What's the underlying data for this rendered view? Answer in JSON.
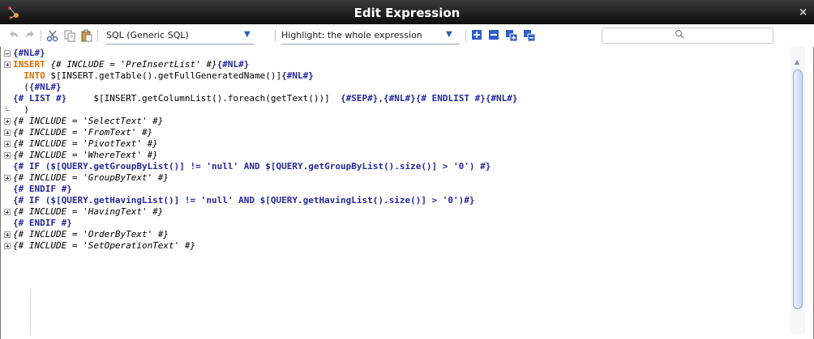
{
  "window": {
    "title": "Edit Expression",
    "close_glyph": "×"
  },
  "toolbar": {
    "language_select": "SQL (Generic SQL)",
    "highlight_select": "Highlight: the whole expression",
    "search_placeholder": ""
  },
  "editor": {
    "lines": [
      {
        "g": "minus",
        "segs": [
          {
            "c": "tpl",
            "t": "{#NL#}"
          }
        ]
      },
      {
        "g": "plus",
        "segs": [
          {
            "c": "kw",
            "t": "INSERT"
          },
          {
            "c": "it",
            "t": " {# INCLUDE = 'PreInsertList' #}"
          },
          {
            "c": "tpl",
            "t": "{#NL#}"
          }
        ]
      },
      {
        "g": "",
        "segs": [
          {
            "c": "kw",
            "t": "  INTO"
          },
          {
            "c": "plain",
            "t": " $[INSERT.getTable().getFullGeneratedName()]"
          },
          {
            "c": "tpl",
            "t": "{#NL#}"
          }
        ]
      },
      {
        "g": "",
        "segs": [
          {
            "c": "plain",
            "t": "  ("
          },
          {
            "c": "tpl",
            "t": "{#NL#}"
          }
        ]
      },
      {
        "g": "",
        "segs": [
          {
            "c": "tpl",
            "t": "{# LIST #}"
          },
          {
            "c": "plain",
            "t": "     $[INSERT.getColumnList().foreach(getText())]  "
          },
          {
            "c": "tpl",
            "t": "{#SEP#}"
          },
          {
            "c": "plain",
            "t": ","
          },
          {
            "c": "tpl",
            "t": "{#NL#}{# ENDLIST #}{#NL#}"
          }
        ]
      },
      {
        "g": "end",
        "segs": [
          {
            "c": "plain",
            "t": "  )"
          }
        ]
      },
      {
        "g": "plus",
        "segs": [
          {
            "c": "it",
            "t": "{# INCLUDE = 'SelectText' #}"
          }
        ]
      },
      {
        "g": "plus",
        "segs": [
          {
            "c": "it",
            "t": "{# INCLUDE = 'FromText' #}"
          }
        ]
      },
      {
        "g": "plus",
        "segs": [
          {
            "c": "it",
            "t": "{# INCLUDE = 'PivotText' #}"
          }
        ]
      },
      {
        "g": "plus",
        "segs": [
          {
            "c": "it",
            "t": "{# INCLUDE = 'WhereText' #}"
          }
        ]
      },
      {
        "g": "",
        "segs": [
          {
            "c": "tpl",
            "t": "{# IF ($[QUERY.getGroupByList()] != 'null' AND $[QUERY.getGroupByList().size()] > '0') #}"
          }
        ]
      },
      {
        "g": "plus",
        "segs": [
          {
            "c": "it",
            "t": "{# INCLUDE = 'GroupByText' #}"
          }
        ]
      },
      {
        "g": "",
        "segs": [
          {
            "c": "tpl",
            "t": "{# ENDIF #}"
          }
        ]
      },
      {
        "g": "",
        "segs": [
          {
            "c": "tpl",
            "t": "{# IF ($[QUERY.getHavingList()] != 'null' AND $[QUERY.getHavingList().size()] > '0')#}"
          }
        ]
      },
      {
        "g": "plus",
        "segs": [
          {
            "c": "it",
            "t": "{# INCLUDE = 'HavingText' #}"
          }
        ]
      },
      {
        "g": "",
        "segs": [
          {
            "c": "tpl",
            "t": "{# ENDIF #}"
          }
        ]
      },
      {
        "g": "plus",
        "segs": [
          {
            "c": "it",
            "t": "{# INCLUDE = 'OrderByText' #}"
          }
        ]
      },
      {
        "g": "plus",
        "segs": [
          {
            "c": "it",
            "t": "{# INCLUDE = 'SetOperationText' #}"
          }
        ]
      }
    ]
  },
  "colors": {
    "template": "#28289b",
    "keyword": "#e06a00",
    "titlebar": "#1a1a1a"
  }
}
